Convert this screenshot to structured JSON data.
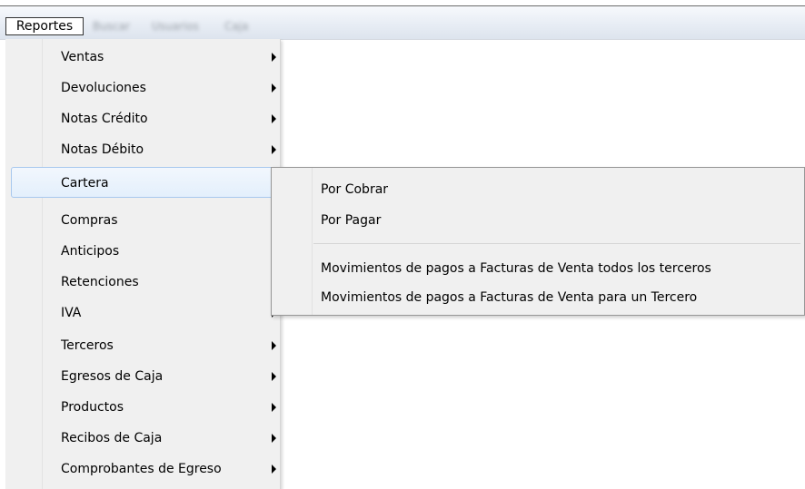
{
  "menubar": {
    "items": [
      {
        "label": "Reportes",
        "active": true
      },
      {
        "label": "Buscar"
      },
      {
        "label": "Usuarios"
      },
      {
        "label": "Caja"
      }
    ]
  },
  "dropdown": {
    "items": [
      {
        "label": "Ventas"
      },
      {
        "label": "Devoluciones"
      },
      {
        "label": "Notas Crédito"
      },
      {
        "label": "Notas Débito"
      },
      {
        "label": "Cartera",
        "highlighted": true
      },
      {
        "label": "Compras"
      },
      {
        "label": "Anticipos"
      },
      {
        "label": "Retenciones"
      },
      {
        "label": "IVA"
      },
      {
        "label": "Terceros"
      },
      {
        "label": "Egresos de Caja"
      },
      {
        "label": "Productos"
      },
      {
        "label": "Recibos de Caja"
      },
      {
        "label": "Comprobantes de Egreso"
      }
    ]
  },
  "submenu": {
    "items": [
      {
        "label": "Por Cobrar"
      },
      {
        "label": "Por Pagar"
      },
      {
        "label": "Movimientos de pagos a Facturas de Venta todos los terceros"
      },
      {
        "label": "Movimientos de pagos a Facturas de Venta para un Tercero"
      }
    ]
  }
}
